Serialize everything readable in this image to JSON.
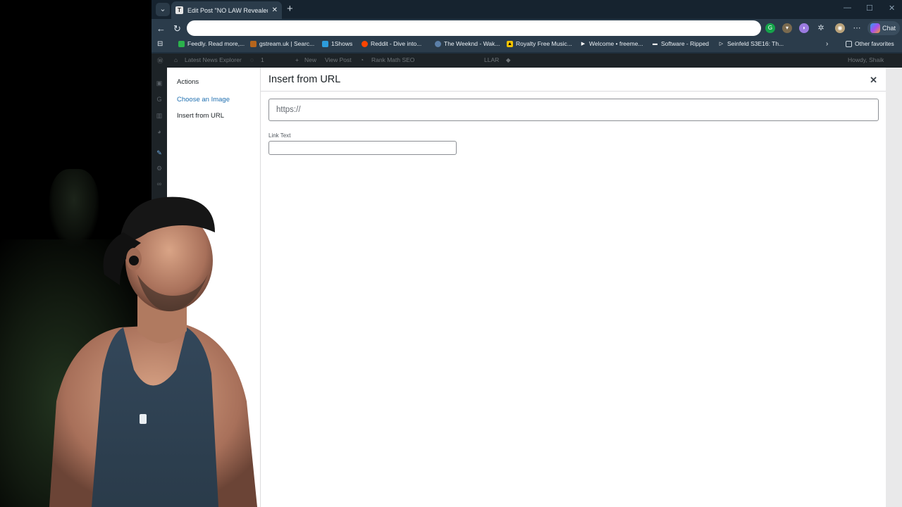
{
  "browser": {
    "tab_title": "Edit Post \"NO LAW Revealed For P",
    "tab_favicon": "T",
    "address": "",
    "chat_label": "Chat"
  },
  "bookmarks": [
    {
      "label": "Feedly. Read more,...",
      "color": "#2bb24c"
    },
    {
      "label": "gstream.uk | Searc...",
      "color": "#b5651d"
    },
    {
      "label": "1Shows",
      "color": "#2d9cdb"
    },
    {
      "label": "Reddit - Dive into...",
      "color": "#ff4500"
    },
    {
      "label": "The Weeknd - Wak...",
      "color": "#5b7fa8"
    },
    {
      "label": "Royalty Free Music...",
      "color": "#f2c200"
    },
    {
      "label": "Welcome • freeme...",
      "color": "#ffffff"
    },
    {
      "label": "Software - Ripped",
      "color": "#cfd8e0"
    },
    {
      "label": "Seinfeld S3E16: Th...",
      "color": "#cfd8e0"
    }
  ],
  "other_favorites": "Other favorites",
  "wp_admin_bar": {
    "site_name": "Latest News Explorer",
    "comments": "1",
    "new": "New",
    "view_post": "View Post",
    "rank_math": "Rank Math SEO",
    "llar": "LLAR",
    "howdy": "Howdy, Shaik"
  },
  "modal": {
    "sidebar_heading": "Actions",
    "sidebar_links": [
      "Choose an Image",
      "Insert from URL"
    ],
    "title": "Insert from URL",
    "url_placeholder": "https://",
    "link_text_label": "Link Text",
    "link_text_value": ""
  },
  "colors": {
    "link": "#2271b1",
    "active_link": "#1d2327",
    "browser_chrome": "#2b3c4b"
  },
  "icons": [
    "tab-search-icon",
    "back-icon",
    "reload-icon",
    "close-icon",
    "plus-icon",
    "copilot-icon",
    "folder-icon",
    "wordpress-icon"
  ]
}
